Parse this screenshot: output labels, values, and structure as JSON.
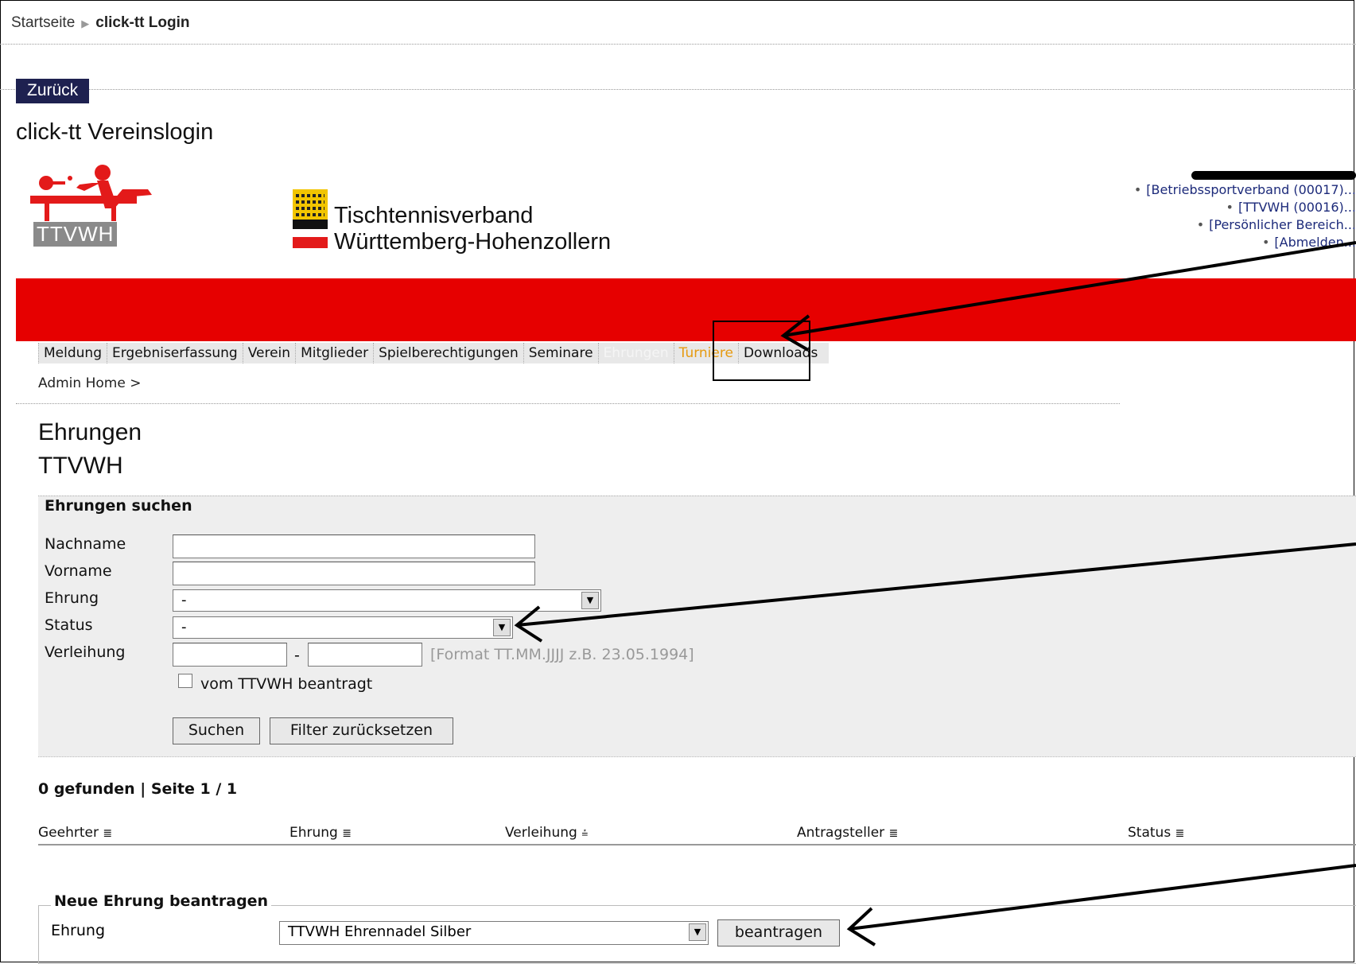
{
  "breadcrumb": {
    "home": "Startseite",
    "current": "click-tt Login"
  },
  "back_button": "Zurück",
  "login_title": "click-tt Vereinslogin",
  "logo": {
    "text": "TTVWH"
  },
  "verband": {
    "line1": "Tischtennisverband",
    "line2": "Württemberg-Hohenzollern"
  },
  "user_links": [
    "[Betriebssportverband (00017)...",
    "[TTVWH (00016)...",
    "[Persönlicher Bereich...",
    "[Abmelden..."
  ],
  "nav": [
    "Meldung",
    "Ergebniserfassung",
    "Verein",
    "Mitglieder",
    "Spielberechtigungen",
    "Seminare",
    "Ehrungen",
    "Turniere",
    "Downloads"
  ],
  "admin_home": "Admin Home >",
  "page_title": "Ehrungen",
  "page_subtitle": "TTVWH",
  "search": {
    "title": "Ehrungen suchen",
    "nachname_label": "Nachname",
    "vorname_label": "Vorname",
    "ehrung_label": "Ehrung",
    "ehrung_value": "-",
    "status_label": "Status",
    "status_value": "-",
    "verleihung_label": "Verleihung",
    "date_sep": "-",
    "date_hint": "[Format TT.MM.JJJJ z.B. 23.05.1994]",
    "checkbox_label": "vom TTVWH beantragt",
    "search_button": "Suchen",
    "reset_button": "Filter zurücksetzen"
  },
  "results": {
    "summary": "0 gefunden | Seite 1 / 1",
    "columns": [
      "Geehrter",
      "Ehrung",
      "Verleihung",
      "Antragsteller",
      "Status"
    ]
  },
  "new_award": {
    "legend": "Neue Ehrung beantragen",
    "label": "Ehrung",
    "value": "TTVWH Ehrennadel Silber",
    "button": "beantragen"
  },
  "colors": {
    "red_bar": "#e60000",
    "back_button": "#1e2150",
    "active_tab": "#f5f5f5",
    "turniere": "#e69a10"
  }
}
